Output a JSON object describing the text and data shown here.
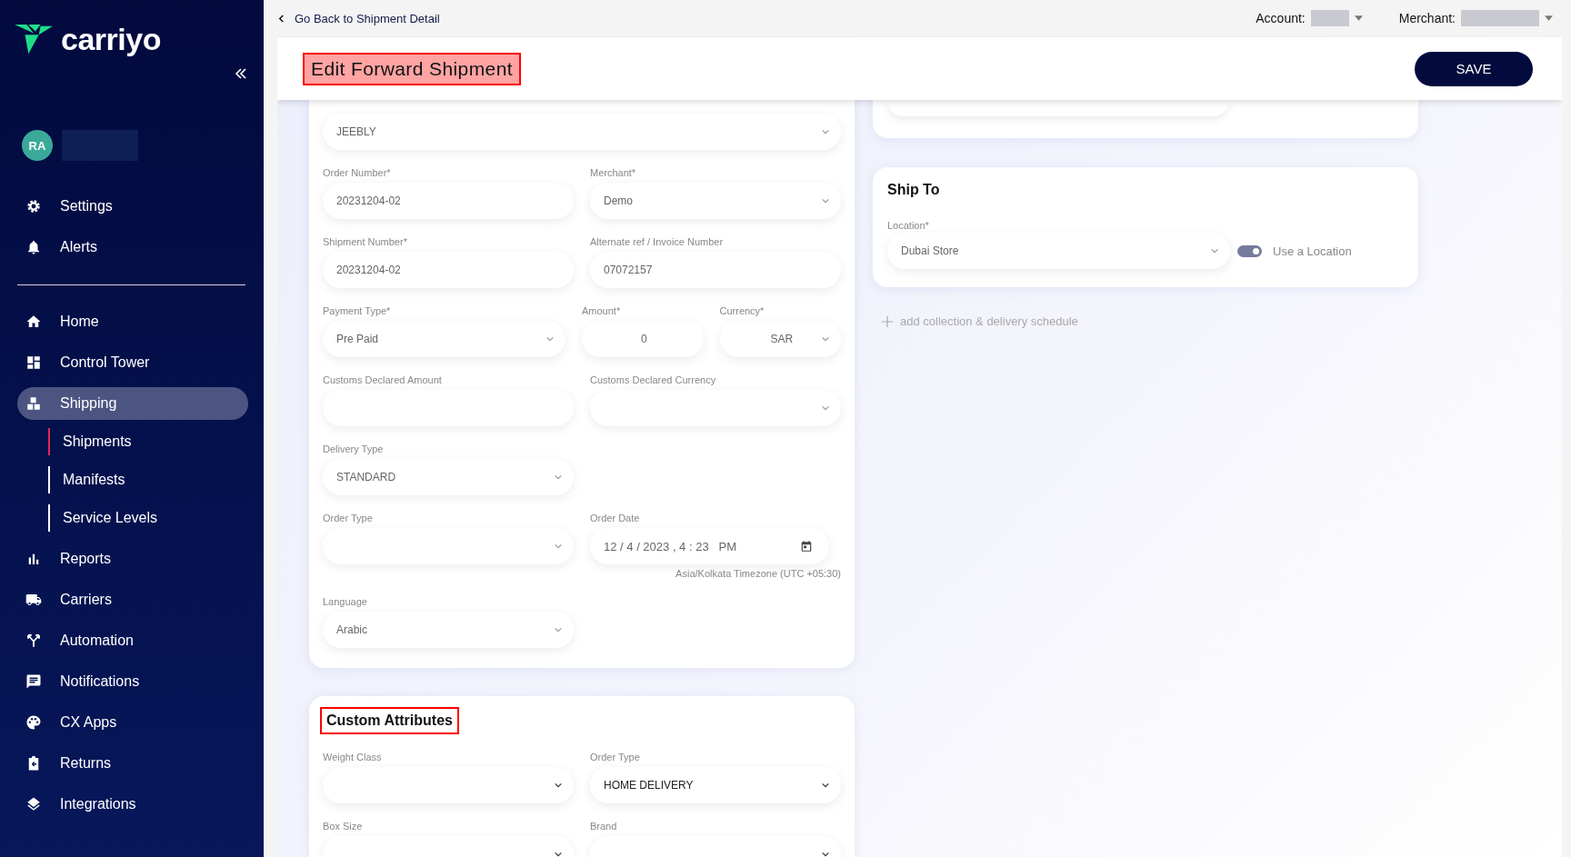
{
  "sidebar": {
    "logo": "carriyo",
    "avatar": "RA",
    "top_items": [
      {
        "label": "Settings",
        "selected": false
      },
      {
        "label": "Alerts",
        "selected": false
      }
    ],
    "items": [
      {
        "label": "Home",
        "selected": false
      },
      {
        "label": "Control Tower",
        "selected": false
      },
      {
        "label": "Shipping",
        "selected": true,
        "children": [
          {
            "label": "Shipments",
            "selected": true
          },
          {
            "label": "Manifests",
            "selected": false
          },
          {
            "label": "Service Levels",
            "selected": false
          }
        ]
      },
      {
        "label": "Reports",
        "selected": false
      },
      {
        "label": "Carriers",
        "selected": false
      },
      {
        "label": "Automation",
        "selected": false
      },
      {
        "label": "Notifications",
        "selected": false
      },
      {
        "label": "CX Apps",
        "selected": false
      },
      {
        "label": "Returns",
        "selected": false
      },
      {
        "label": "Integrations",
        "selected": false
      }
    ]
  },
  "top_bar": {
    "back_link": "Go Back to Shipment Detail",
    "account_label": "Account:",
    "merchant_label": "Merchant:"
  },
  "header": {
    "title": "Edit Forward Shipment",
    "highlighted": true,
    "save_button": "SAVE"
  },
  "shipment_form": {
    "carrier": {
      "kind": "select",
      "value": "JEEBLY"
    },
    "rows": [
      [
        {
          "label": "Order Number*",
          "kind": "text",
          "value": "20231204-02"
        },
        {
          "label": "Merchant*",
          "kind": "select",
          "value": "Demo"
        }
      ],
      [
        {
          "label": "Shipment Number*",
          "kind": "text",
          "value": "20231204-02"
        },
        {
          "label": "Alternate ref / Invoice Number",
          "kind": "text",
          "value": "07072157"
        }
      ],
      [
        {
          "label": "Payment Type*",
          "kind": "select",
          "value": "Pre Paid"
        },
        {
          "label": "Amount*",
          "kind": "text",
          "value": "0"
        },
        {
          "label": "Currency*",
          "kind": "select",
          "value": "SAR"
        }
      ],
      [
        {
          "label": "Customs Declared Amount",
          "kind": "text"
        },
        {
          "label": "Customs Declared Currency",
          "kind": "select"
        }
      ],
      [
        {
          "label": "Delivery Type",
          "kind": "select",
          "value": "STANDARD"
        }
      ],
      [
        {
          "label": "Order Type",
          "kind": "select"
        },
        {
          "label": "Order Date",
          "kind": "datetime",
          "value": "12 / 4 / 2023 , 4 : 23   PM",
          "note": "Asia/Kolkata Timezone (UTC +05:30)"
        }
      ],
      [
        {
          "label": "Language",
          "kind": "select",
          "value": "Arabic"
        }
      ]
    ]
  },
  "custom_attributes": {
    "title": "Custom Attributes",
    "highlighted": true,
    "rows": [
      [
        {
          "label": "Weight Class",
          "kind": "select"
        },
        {
          "label": "Order Type",
          "kind": "select",
          "value": "HOME DELIVERY"
        }
      ],
      [
        {
          "label": "Box Size",
          "kind": "select"
        },
        {
          "label": "Brand",
          "kind": "select"
        }
      ]
    ]
  },
  "ship_to": {
    "title": "Ship To",
    "location_label": "Location*",
    "location": "Dubai Store",
    "use_location": {
      "on": true,
      "label": "Use a Location"
    }
  },
  "schedule_link": "add collection & delivery schedule"
}
